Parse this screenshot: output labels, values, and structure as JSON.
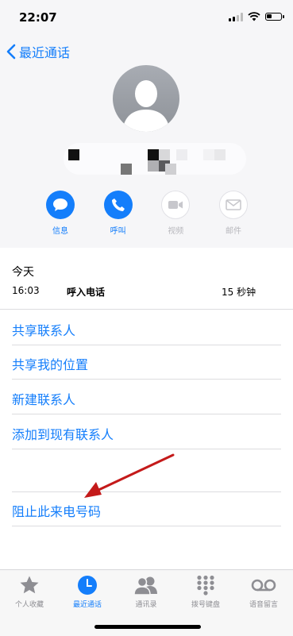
{
  "status_bar": {
    "time": "22:07"
  },
  "nav": {
    "back_label": "最近通话"
  },
  "actions": [
    {
      "label": "信息",
      "icon": "message-icon",
      "enabled": true
    },
    {
      "label": "呼叫",
      "icon": "phone-icon",
      "enabled": true
    },
    {
      "label": "视频",
      "icon": "video-icon",
      "enabled": false
    },
    {
      "label": "邮件",
      "icon": "mail-icon",
      "enabled": false
    }
  ],
  "call_log": {
    "section_title": "今天",
    "entries": [
      {
        "time": "16:03",
        "type": "呼入电话",
        "duration": "15 秒钟"
      }
    ]
  },
  "menu": {
    "share_contact": "共享联系人",
    "share_location": "共享我的位置",
    "new_contact": "新建联系人",
    "add_to_existing": "添加到现有联系人",
    "block_caller": "阻止此来电号码"
  },
  "tabbar": {
    "items": [
      {
        "label": "个人收藏",
        "icon": "star-icon",
        "active": false
      },
      {
        "label": "最近通话",
        "icon": "clock-icon",
        "active": true
      },
      {
        "label": "通讯录",
        "icon": "contacts-icon",
        "active": false
      },
      {
        "label": "拨号键盘",
        "icon": "keypad-icon",
        "active": false
      },
      {
        "label": "语音留言",
        "icon": "voicemail-icon",
        "active": false
      }
    ]
  },
  "colors": {
    "accent": "#147efb",
    "annotation_arrow": "#c41a1a",
    "disabled": "#b8b8bd"
  }
}
